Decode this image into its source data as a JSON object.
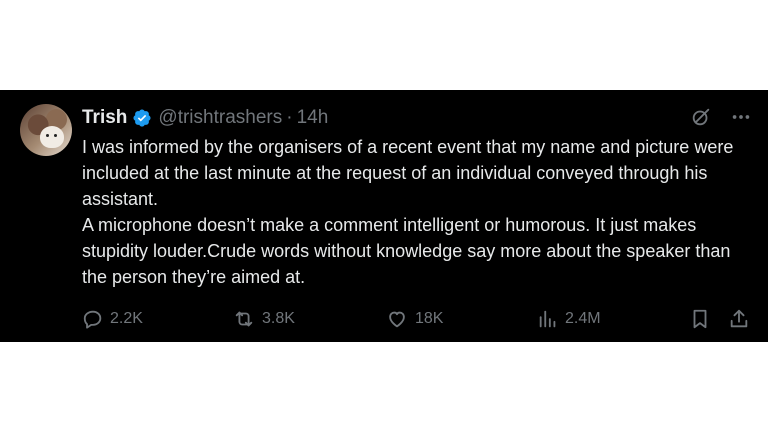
{
  "tweet": {
    "author_name": "Trish",
    "handle": "@trishtrashers",
    "separator": "·",
    "time": "14h",
    "paragraphs": [
      "I was informed by the organisers of a recent event that my name and picture were included at the last minute at the request of an individual conveyed through his assistant.",
      "A microphone doesn’t make a comment intelligent or humorous. It just makes stupidity louder.Crude words without knowledge say more about the speaker than the person they’re aimed at."
    ]
  },
  "actions": {
    "replies": "2.2K",
    "reposts": "3.8K",
    "likes": "18K",
    "views": "2.4M"
  },
  "icons": {
    "verified": "verified-badge-icon",
    "grok": "grok-icon",
    "more": "more-icon",
    "reply": "reply-icon",
    "repost": "repost-icon",
    "like": "heart-icon",
    "views": "views-icon",
    "bookmark": "bookmark-icon",
    "share": "share-icon"
  },
  "colors": {
    "background": "#000000",
    "text": "#e7e9ea",
    "muted": "#71767b",
    "verified": "#1d9bf0"
  }
}
